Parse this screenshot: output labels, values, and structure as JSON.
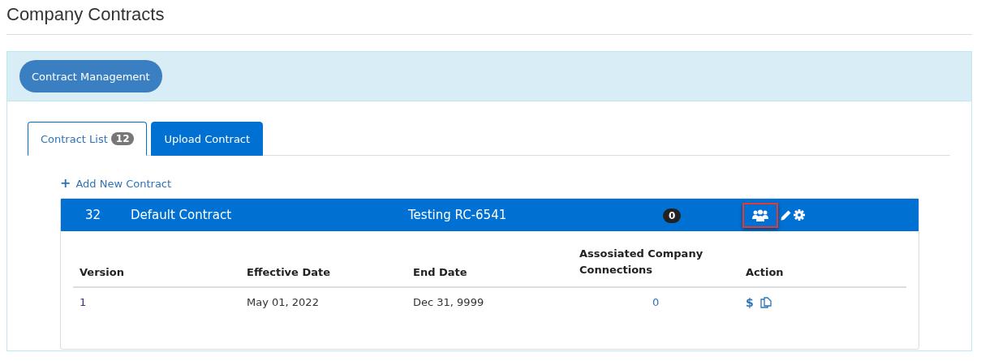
{
  "page_title": "Company Contracts",
  "panel": {
    "header_button": "Contract Management"
  },
  "tabs": [
    {
      "label": "Contract List",
      "count": "12",
      "selected": true
    },
    {
      "label": "Upload Contract",
      "selected": false
    }
  ],
  "add_link": {
    "icon": "+",
    "label": "Add New Contract"
  },
  "contract": {
    "id": "32",
    "name": "Default Contract",
    "description": "Testing RC-6541",
    "connections": "0",
    "actions": [
      {
        "kind": "people",
        "highlighted": true
      },
      {
        "kind": "edit",
        "highlighted": false
      },
      {
        "kind": "settings",
        "highlighted": false
      }
    ],
    "table": {
      "columns": [
        "Version",
        "Effective Date",
        "End Date",
        "Assosiated Company Connections",
        "Action"
      ],
      "rows": [
        {
          "version": "1",
          "effective_date": "May 01, 2022",
          "end_date": "Dec 31, 9999",
          "connections": "0",
          "price_symbol": "$"
        }
      ]
    }
  }
}
